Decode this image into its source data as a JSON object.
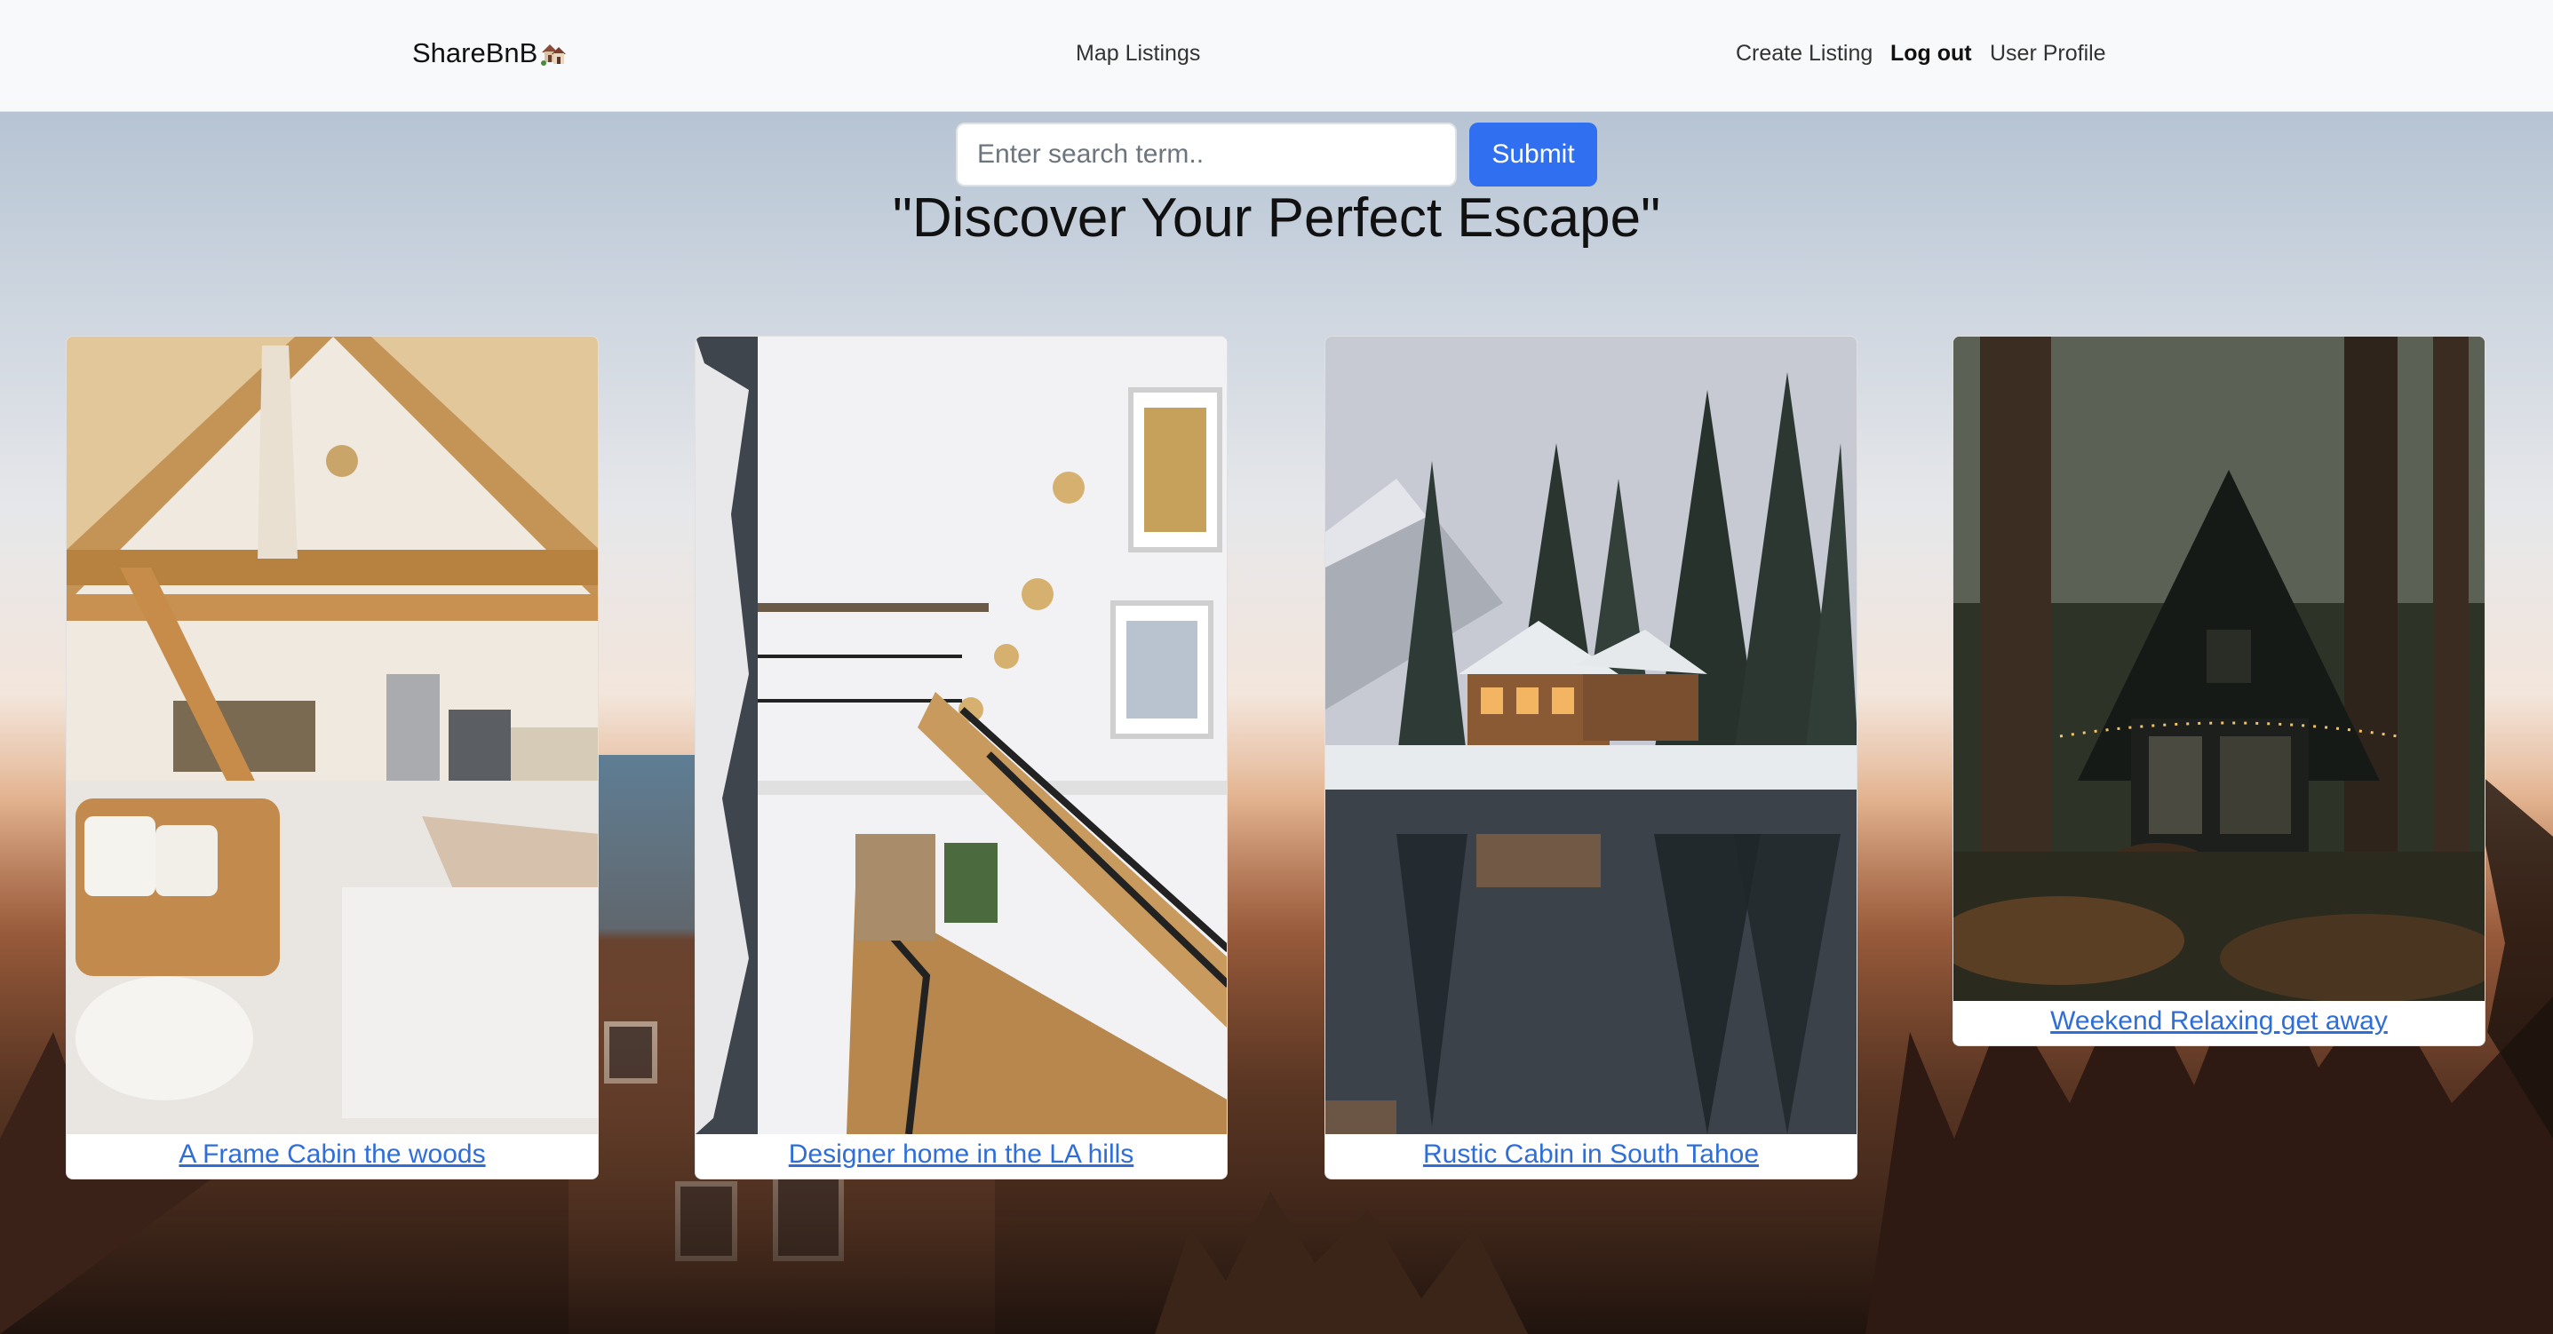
{
  "navbar": {
    "brand": "ShareBnB",
    "brand_icon": "house-emoji-icon",
    "map_listings": "Map Listings",
    "create_listing": "Create Listing",
    "log_out": "Log out",
    "user_profile": "User Profile"
  },
  "search": {
    "placeholder": "Enter search term..",
    "value": "",
    "submit_label": "Submit"
  },
  "headline": "\"Discover Your Perfect Escape\"",
  "listings": [
    {
      "title": "A Frame Cabin the woods",
      "image": "a-frame-cabin-interior"
    },
    {
      "title": "Designer home in the LA hills",
      "image": "staircase-interior"
    },
    {
      "title": "Rustic Cabin in South Tahoe",
      "image": "snowy-lake-cabin"
    },
    {
      "title": "Weekend Relaxing get away",
      "image": "dark-a-frame-forest"
    }
  ],
  "colors": {
    "navbar_bg": "#f8f9fa",
    "submit_bg": "#2f6ff0",
    "link": "#2f6ed8"
  }
}
